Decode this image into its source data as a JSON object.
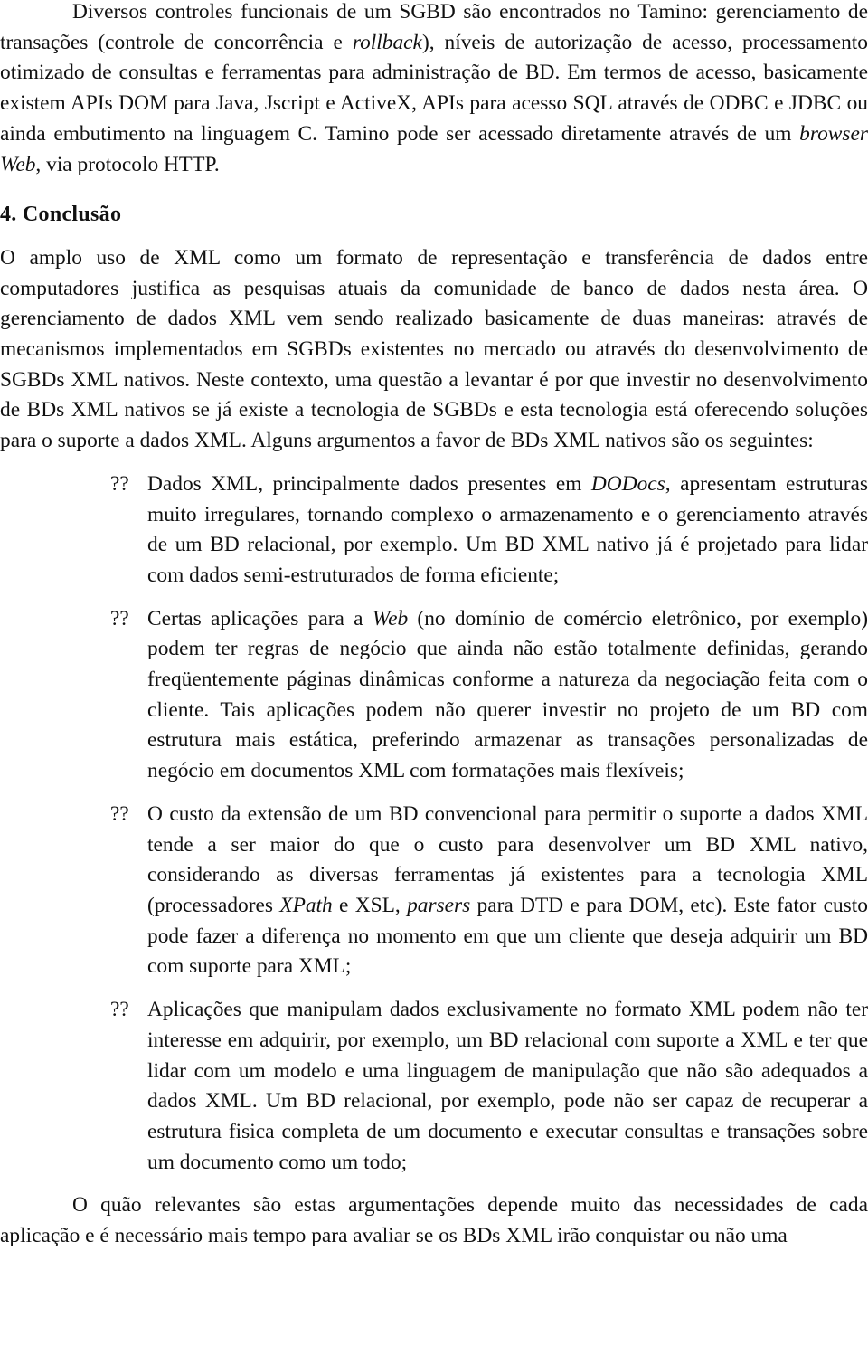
{
  "intro_paragraph": {
    "segments": [
      {
        "text": "Diversos controles funcionais de um SGBD são encontrados no Tamino: gerenciamento de transações (controle de concorrência e ",
        "italic": false
      },
      {
        "text": "rollback",
        "italic": true
      },
      {
        "text": "), níveis de autorização de acesso, processamento otimizado de consultas e ferramentas para administração de BD. Em termos de acesso, basicamente existem APIs DOM para Java, Jscript e ActiveX, APIs para acesso SQL através de ODBC e JDBC ou ainda embutimento  na linguagem C. Tamino pode ser acessado diretamente através de um ",
        "italic": false
      },
      {
        "text": "browser Web",
        "italic": true
      },
      {
        "text": ", via protocolo HTTP.",
        "italic": false
      }
    ]
  },
  "section": {
    "heading": "4. Conclusão",
    "paragraph": "O amplo uso de XML como um formato de representação e transferência de dados entre computadores justifica as pesquisas atuais da comunidade de banco de dados nesta área. O gerenciamento de dados XML vem sendo realizado basicamente de duas maneiras: através de mecanismos implementados em SGBDs existentes no mercado ou através do desenvolvimento de SGBDs XML nativos. Neste contexto, uma questão a levantar é por que investir no desenvolvimento de BDs XML nativos se já existe a tecnologia de SGBDs e esta tecnologia está oferecendo soluções para o suporte a dados XML. Alguns argumentos a favor de BDs XML nativos são os seguintes:"
  },
  "list": {
    "bullet_marker": "??",
    "items": [
      {
        "segments": [
          {
            "text": "Dados XML, principalmente dados presentes em ",
            "italic": false
          },
          {
            "text": "DODocs",
            "italic": true
          },
          {
            "text": ", apresentam estruturas muito irregulares, tornando complexo o armazenamento e o gerenciamento através de um BD relacional, por exemplo. Um BD XML nativo já é projetado para lidar com dados semi-estruturados de forma eficiente;",
            "italic": false
          }
        ]
      },
      {
        "segments": [
          {
            "text": "Certas aplicações para a ",
            "italic": false
          },
          {
            "text": "Web",
            "italic": true
          },
          {
            "text": " (no domínio de comércio eletrônico, por exemplo) podem ter regras de negócio que ainda não estão totalmente definidas, gerando freqüentemente páginas dinâmicas conforme a natureza da negociação feita com o cliente. Tais aplicações podem não querer investir no projeto de um BD com estrutura mais estática, preferindo armazenar as transações personalizadas de negócio em documentos XML com formatações mais flexíveis;",
            "italic": false
          }
        ]
      },
      {
        "segments": [
          {
            "text": "O custo da extensão de um BD convencional para permitir o suporte a dados XML tende a ser maior do que o custo para desenvolver um BD XML nativo, considerando as diversas ferramentas já existentes para a tecnologia XML (processadores ",
            "italic": false
          },
          {
            "text": "XPath",
            "italic": true
          },
          {
            "text": " e XSL, ",
            "italic": false
          },
          {
            "text": "parsers",
            "italic": true
          },
          {
            "text": " para DTD e para DOM, etc). Este fator custo pode fazer a diferença no momento em que um cliente que deseja adquirir um BD com suporte para XML;",
            "italic": false
          }
        ]
      },
      {
        "segments": [
          {
            "text": "Aplicações que manipulam dados exclusivamente no formato XML podem não ter interesse em adquirir, por exemplo, um BD relacional com suporte a XML e ter que lidar com um modelo e uma linguagem de manipulação que não são adequados a dados XML. Um BD relacional, por exemplo, pode não ser capaz de recuperar a estrutura fisica completa de um documento e executar consultas e transações sobre um documento como um todo;",
            "italic": false
          }
        ]
      }
    ]
  },
  "closing_paragraph": "O quão relevantes são estas argumentações depende muito das necessidades de cada aplicação e é necessário mais tempo para avaliar se os BDs XML irão conquistar ou não uma"
}
